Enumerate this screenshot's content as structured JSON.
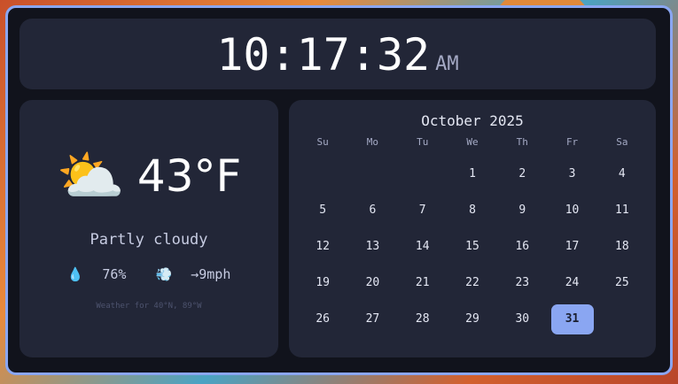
{
  "clock": {
    "time": "10:17:32",
    "ampm": "AM"
  },
  "weather": {
    "icon": "⛅",
    "icon_name": "partly-cloudy-icon",
    "temperature": "43°F",
    "condition": "Partly cloudy",
    "humidity_icon": "💧",
    "humidity": "76%",
    "wind_icon": "💨",
    "wind": "→9mph",
    "location": "Weather for 40°N, 89°W"
  },
  "calendar": {
    "title": "October 2025",
    "weekdays": [
      "Su",
      "Mo",
      "Tu",
      "We",
      "Th",
      "Fr",
      "Sa"
    ],
    "leading_blanks": 3,
    "days": [
      "1",
      "2",
      "3",
      "4",
      "5",
      "6",
      "7",
      "8",
      "9",
      "10",
      "11",
      "12",
      "13",
      "14",
      "15",
      "16",
      "17",
      "18",
      "19",
      "20",
      "21",
      "22",
      "23",
      "24",
      "25",
      "26",
      "27",
      "28",
      "29",
      "30",
      "31"
    ],
    "today": "31"
  },
  "colors": {
    "accent": "#8aa6f2",
    "panel": "#222637",
    "background": "#11131c"
  }
}
